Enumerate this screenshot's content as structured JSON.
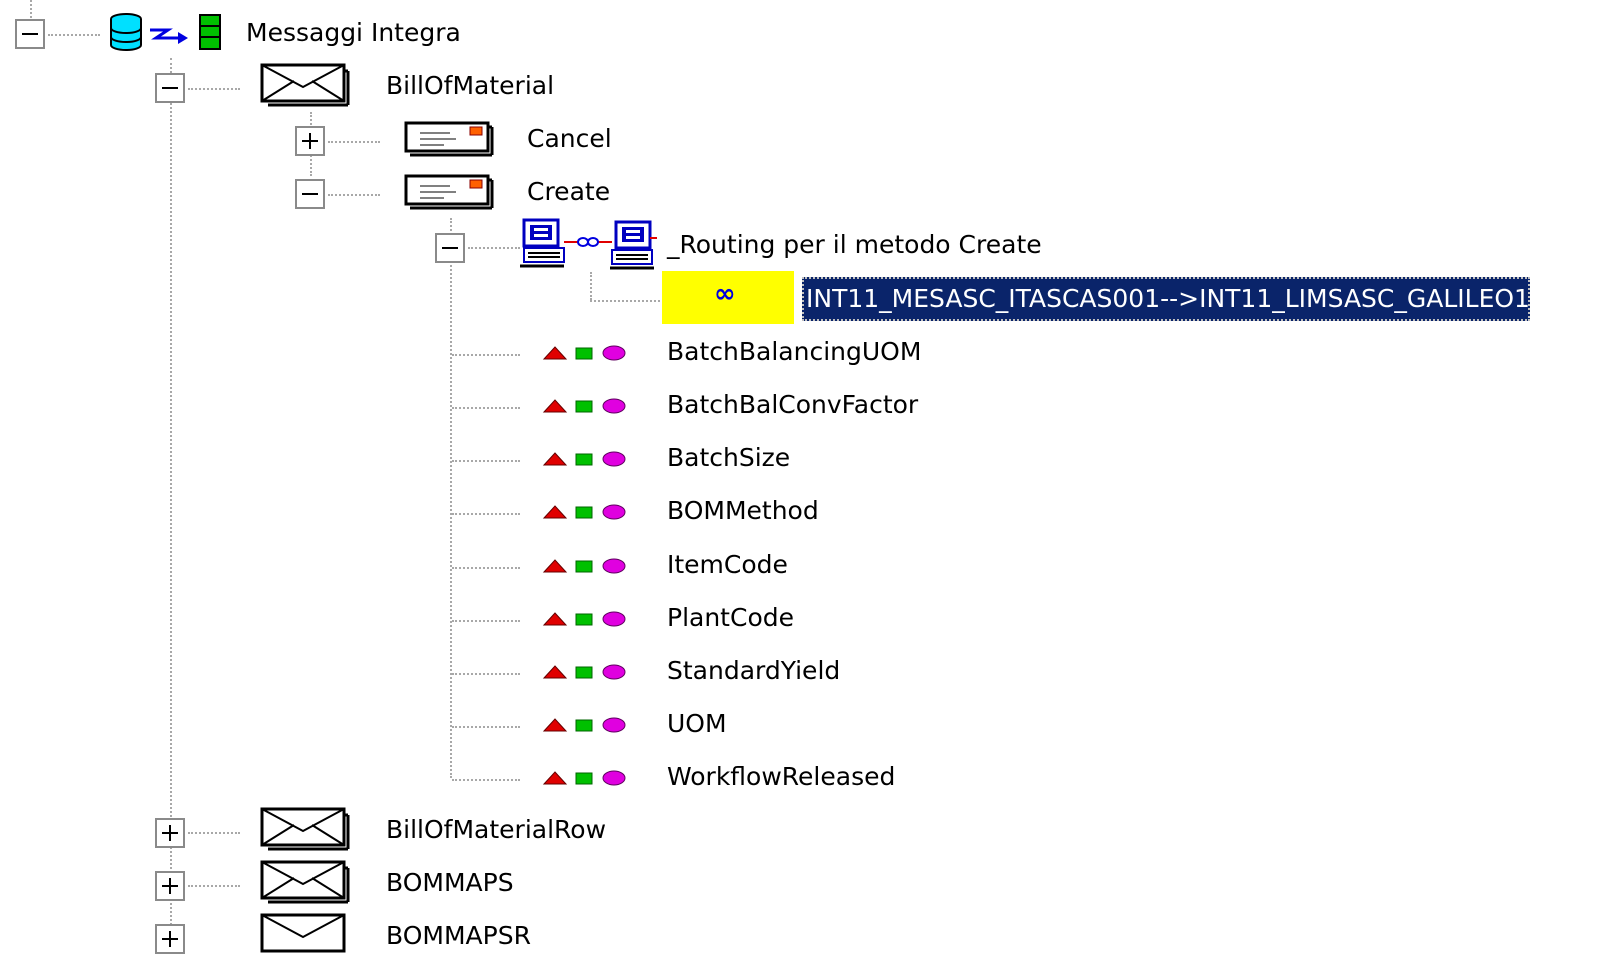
{
  "colors": {
    "tree_line": "#a8a8a8",
    "selection_bg": "#0a246a",
    "selection_text": "#ffffff",
    "routing_badge_bg": "#ffff00",
    "field_triangle": "#e00000",
    "field_square": "#00c000",
    "field_oval": "#e000e0"
  },
  "tree": {
    "root": {
      "label": "Messaggi Integra",
      "expander": "minus",
      "icon": "database-to-server-icon"
    },
    "messages": [
      {
        "label": "BillOfMaterial",
        "expander": "minus",
        "icon": "envelope-icon",
        "methods": [
          {
            "label": "Cancel",
            "expander": "plus",
            "icon": "message-card-icon"
          },
          {
            "label": "Create",
            "expander": "minus",
            "icon": "message-card-icon",
            "routing": {
              "label": "_Routing per il metodo Create",
              "expander": "minus",
              "icon": "networked-computers-icon",
              "badge_symbol": "∞",
              "route_label": "INT11_MESASC_ITASCAS001-->INT11_LIMSASC_GALILEO1"
            },
            "fields": [
              "BatchBalancingUOM",
              "BatchBalConvFactor",
              "BatchSize",
              "BOMMethod",
              "ItemCode",
              "PlantCode",
              "StandardYield",
              "UOM",
              "WorkflowReleased"
            ]
          }
        ]
      },
      {
        "label": "BillOfMaterialRow",
        "expander": "plus",
        "icon": "envelope-icon"
      },
      {
        "label": "BOMMAPS",
        "expander": "plus",
        "icon": "envelope-icon"
      },
      {
        "label": "BOMMAPSR",
        "expander": "plus",
        "icon": "envelope-icon"
      }
    ]
  }
}
